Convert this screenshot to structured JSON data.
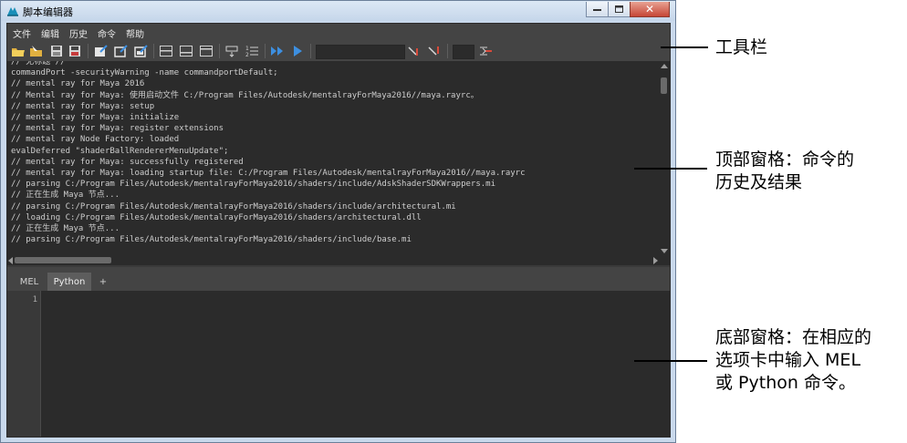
{
  "window": {
    "title": "脚本编辑器",
    "close_glyph": "✕"
  },
  "menu": [
    "文件",
    "编辑",
    "历史",
    "命令",
    "帮助"
  ],
  "history": {
    "lines": [
      "// 无标题 //",
      "commandPort -securityWarning -name commandportDefault;",
      "// mental ray for Maya 2016",
      "// Mental ray for Maya: 使用启动文件 C:/Program Files/Autodesk/mentalrayForMaya2016//maya.rayrc。",
      "// mental ray for Maya: setup",
      "// mental ray for Maya: initialize",
      "// mental ray for Maya: register extensions",
      "// mental ray Node Factory: loaded",
      "evalDeferred \"shaderBallRendererMenuUpdate\";",
      "// mental ray for Maya: successfully registered",
      "// mental ray for Maya: loading startup file: C:/Program Files/Autodesk/mentalrayForMaya2016//maya.rayrc",
      "// parsing C:/Program Files/Autodesk/mentalrayForMaya2016/shaders/include/AdskShaderSDKWrappers.mi",
      "// 正在生成 Maya 节点...",
      "// parsing C:/Program Files/Autodesk/mentalrayForMaya2016/shaders/include/architectural.mi",
      "// loading C:/Program Files/Autodesk/mentalrayForMaya2016/shaders/architectural.dll",
      "// 正在生成 Maya 节点...",
      "// parsing C:/Program Files/Autodesk/mentalrayForMaya2016/shaders/include/base.mi"
    ]
  },
  "tabs": [
    {
      "label": "MEL",
      "active": false
    },
    {
      "label": "Python",
      "active": true
    },
    {
      "label": "+",
      "active": false
    }
  ],
  "editor": {
    "line_numbers": [
      "1"
    ]
  },
  "callouts": {
    "toolbar": "工具栏",
    "top_pane_line1": "顶部窗格：命令的",
    "top_pane_line2": "历史及结果",
    "bottom_pane_line1": "底部窗格：在相应的",
    "bottom_pane_line2": "选项卡中输入 MEL",
    "bottom_pane_line3": "或 Python 命令。"
  },
  "colors": {
    "panel_bg": "#444444",
    "text_area_bg": "#2b2b2b",
    "text": "#cdcdcd",
    "accent_blue": "#3d8fe0"
  }
}
